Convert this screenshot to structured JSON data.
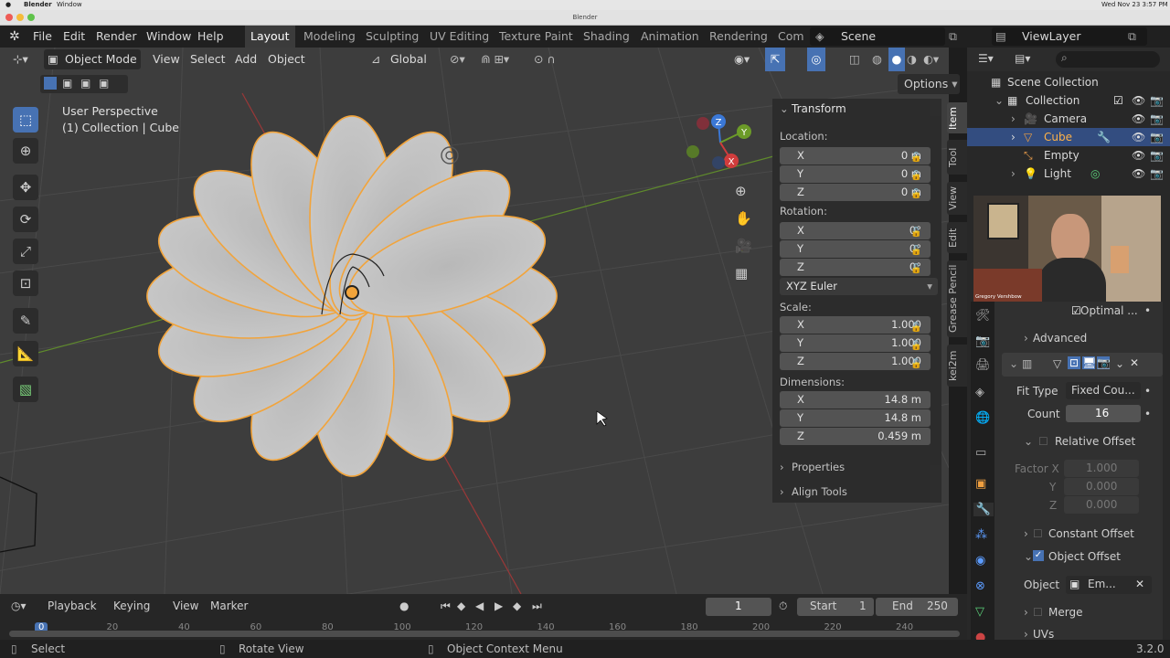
{
  "mac": {
    "app": "Blender",
    "menu_window": "Window",
    "clock": "Wed Nov 23  3:57 PM"
  },
  "window_title": "Blender",
  "menus": [
    "File",
    "Edit",
    "Render",
    "Window",
    "Help"
  ],
  "workspaces": [
    "Layout",
    "Modeling",
    "Sculpting",
    "UV Editing",
    "Texture Paint",
    "Shading",
    "Animation",
    "Rendering",
    "Com"
  ],
  "scene": "Scene",
  "view_layer": "ViewLayer",
  "viewport": {
    "mode": "Object Mode",
    "menu": [
      "View",
      "Select",
      "Add",
      "Object"
    ],
    "orientation": "Global",
    "options": "Options",
    "persp": "User Perspective",
    "collection_info": "(1) Collection | Cube",
    "gizmo": {
      "x": "X",
      "y": "Y",
      "z": "Z"
    }
  },
  "transform": {
    "title": "Transform",
    "location_label": "Location:",
    "location": [
      {
        "ax": "X",
        "v": "0 m"
      },
      {
        "ax": "Y",
        "v": "0 m"
      },
      {
        "ax": "Z",
        "v": "0 m"
      }
    ],
    "rotation_label": "Rotation:",
    "rotation": [
      {
        "ax": "X",
        "v": "0°"
      },
      {
        "ax": "Y",
        "v": "0°"
      },
      {
        "ax": "Z",
        "v": "0°"
      }
    ],
    "rotation_mode": "XYZ Euler",
    "scale_label": "Scale:",
    "scale": [
      {
        "ax": "X",
        "v": "1.000"
      },
      {
        "ax": "Y",
        "v": "1.000"
      },
      {
        "ax": "Z",
        "v": "1.000"
      }
    ],
    "dimensions_label": "Dimensions:",
    "dimensions": [
      {
        "ax": "X",
        "v": "14.8 m"
      },
      {
        "ax": "Y",
        "v": "14.8 m"
      },
      {
        "ax": "Z",
        "v": "0.459 m"
      }
    ],
    "properties": "Properties",
    "align_tools": "Align Tools"
  },
  "vtabs": [
    "Item",
    "Tool",
    "View",
    "Edit",
    "Grease Pencil",
    "kei2m"
  ],
  "outliner": {
    "root": "Scene Collection",
    "items": [
      {
        "label": "Collection"
      },
      {
        "label": "Camera"
      },
      {
        "label": "Cube"
      },
      {
        "label": "Empty"
      },
      {
        "label": "Light"
      }
    ]
  },
  "webcam_name": "Gregory Vershbow",
  "modifier": {
    "optimal": "Optimal ...",
    "advanced": "Advanced",
    "fit_type_label": "Fit Type",
    "fit_type": "Fixed Cou...",
    "count_label": "Count",
    "count": "16",
    "relative_offset": "Relative Offset",
    "factor_x_label": "Factor X",
    "factor_x": "1.000",
    "y_label": "Y",
    "y": "0.000",
    "z_label": "Z",
    "z": "0.000",
    "constant_offset": "Constant Offset",
    "object_offset": "Object Offset",
    "object_label": "Object",
    "object_value": "Em...",
    "merge": "Merge",
    "uvs": "UVs"
  },
  "timeline": {
    "menu": [
      "Playback",
      "Keying",
      "View",
      "Marker"
    ],
    "current": "1",
    "start_label": "Start",
    "start": "1",
    "end_label": "End",
    "end": "250",
    "ticks": [
      "0",
      "20",
      "40",
      "60",
      "80",
      "100",
      "120",
      "140",
      "160",
      "180",
      "200",
      "220",
      "240"
    ]
  },
  "status": {
    "select": "Select",
    "rotate": "Rotate View",
    "context": "Object Context Menu",
    "version": "3.2.0"
  },
  "colors": {
    "accent": "#4772b3",
    "selection": "#ffa033",
    "viewport_bg": "#3d3d3d"
  }
}
